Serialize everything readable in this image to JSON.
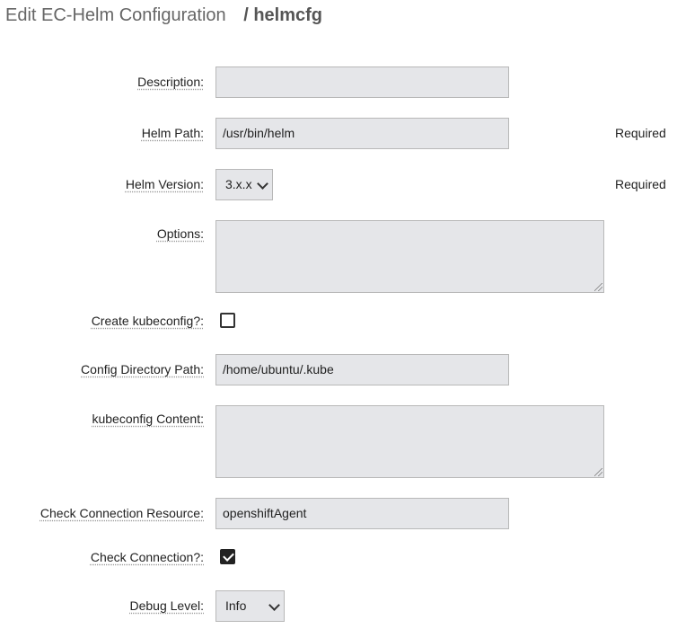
{
  "header": {
    "title": "Edit EC-Helm Configuration",
    "separator": "/",
    "config_name": "helmcfg"
  },
  "form": {
    "description": {
      "label": "Description:",
      "value": ""
    },
    "helm_path": {
      "label": "Helm Path:",
      "value": "/usr/bin/helm",
      "note": "Required"
    },
    "helm_version": {
      "label": "Helm Version:",
      "value": "3.x.x",
      "note": "Required"
    },
    "options": {
      "label": "Options:",
      "value": ""
    },
    "create_kubeconfig": {
      "label": "Create kubeconfig?:",
      "checked": false
    },
    "config_directory_path": {
      "label": "Config Directory Path:",
      "value": "/home/ubuntu/.kube"
    },
    "kubeconfig_content": {
      "label": "kubeconfig Content:",
      "value": ""
    },
    "check_connection_resource": {
      "label": "Check Connection Resource:",
      "value": "openshiftAgent"
    },
    "check_connection": {
      "label": "Check Connection?:",
      "checked": true
    },
    "debug_level": {
      "label": "Debug Level:",
      "value": "Info"
    }
  },
  "icons": {
    "dropdown": "chevron-down-icon",
    "checkmark": "check-icon",
    "resize": "resize-grip-icon"
  }
}
